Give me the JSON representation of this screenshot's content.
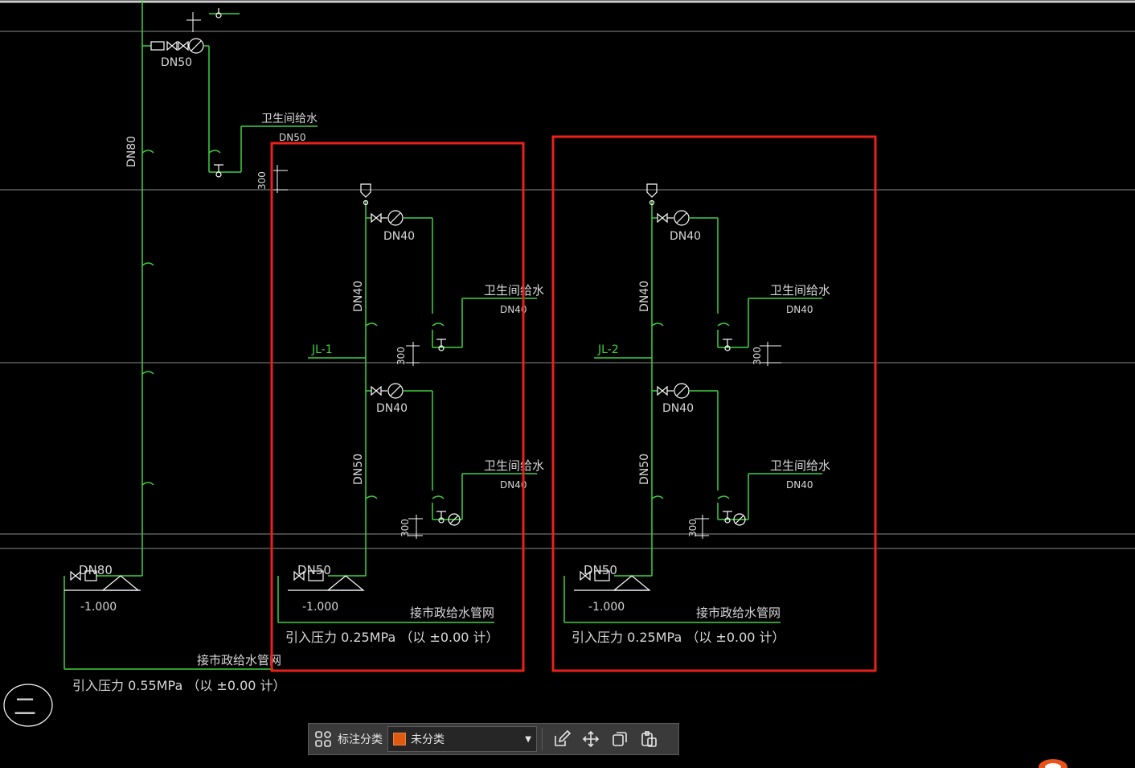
{
  "drawing": {
    "left_system": {
      "labels": {
        "dn80_vertical": "DN80",
        "dn50_top": "DN50",
        "branch_title": "卫生间给水",
        "branch_dn": "DN50",
        "dim_300": "300",
        "inlet_dn": "DN80",
        "inlet_elev": "-1.000",
        "main_net": "接市政给水管网",
        "pressure": "引入压力 0.55MPa （以 ±0.00 计）"
      }
    },
    "system_1": {
      "riser": "JL-1",
      "upper_meter_dn": "DN40",
      "upper_riser_dn": "DN40",
      "upper_branch_title": "卫生间给水",
      "upper_branch_dn": "DN40",
      "upper_dim": "300",
      "lower_meter_dn": "DN40",
      "lower_riser_dn": "DN50",
      "lower_branch_title": "卫生间给水",
      "lower_branch_dn": "DN40",
      "lower_dim": "300",
      "inlet_dn": "DN50",
      "inlet_elev": "-1.000",
      "main_net": "接市政给水管网",
      "pressure": "引入压力 0.25MPa （以 ±0.00 计）"
    },
    "system_2": {
      "riser": "JL-2",
      "upper_meter_dn": "DN40",
      "upper_riser_dn": "DN40",
      "upper_branch_title": "卫生间给水",
      "upper_branch_dn": "DN40",
      "upper_dim": "300",
      "lower_meter_dn": "DN40",
      "lower_riser_dn": "DN50",
      "lower_branch_title": "卫生间给水",
      "lower_branch_dn": "DN40",
      "lower_dim": "300",
      "inlet_dn": "DN50",
      "inlet_elev": "-1.000",
      "main_net": "接市政给水管网",
      "pressure": "引入压力 0.25MPa （以 ±0.00 计）"
    },
    "section_mark": "二",
    "colors": {
      "pipe": "#3fd23f",
      "text": "#d8d8d8",
      "highlight": "#e8221a",
      "grid": "#8c8c8c"
    }
  },
  "toolbar": {
    "category_label": "标注分类",
    "selected_category": "未分类",
    "icons": [
      "grid-apps-icon",
      "edit-icon",
      "move-icon",
      "copy-icon",
      "paste-icon"
    ]
  }
}
